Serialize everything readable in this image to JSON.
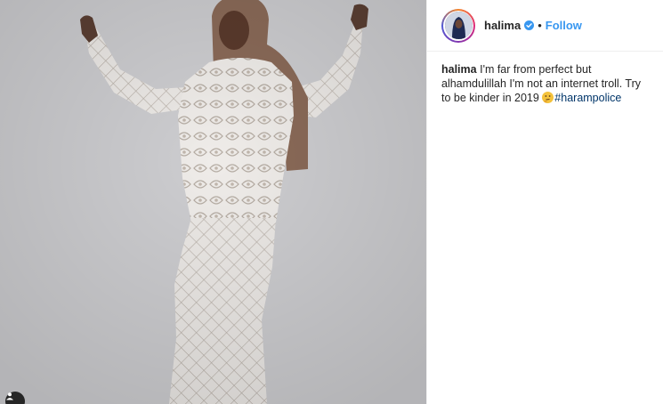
{
  "post": {
    "username": "halima",
    "follow_label": "Follow",
    "separator": "•",
    "caption": {
      "username": "halima",
      "text": "I'm far from perfect but alhamdulillah I'm not an internet troll. Try to be kinder in 2019",
      "emoji": "thinking-face-emoji",
      "hashtag": "#harampolice"
    },
    "media": {
      "description_icon": "user-tag-icon"
    }
  },
  "colors": {
    "follow": "#3897f0",
    "hashtag": "#003569",
    "text": "#262626",
    "border": "#efefef"
  }
}
